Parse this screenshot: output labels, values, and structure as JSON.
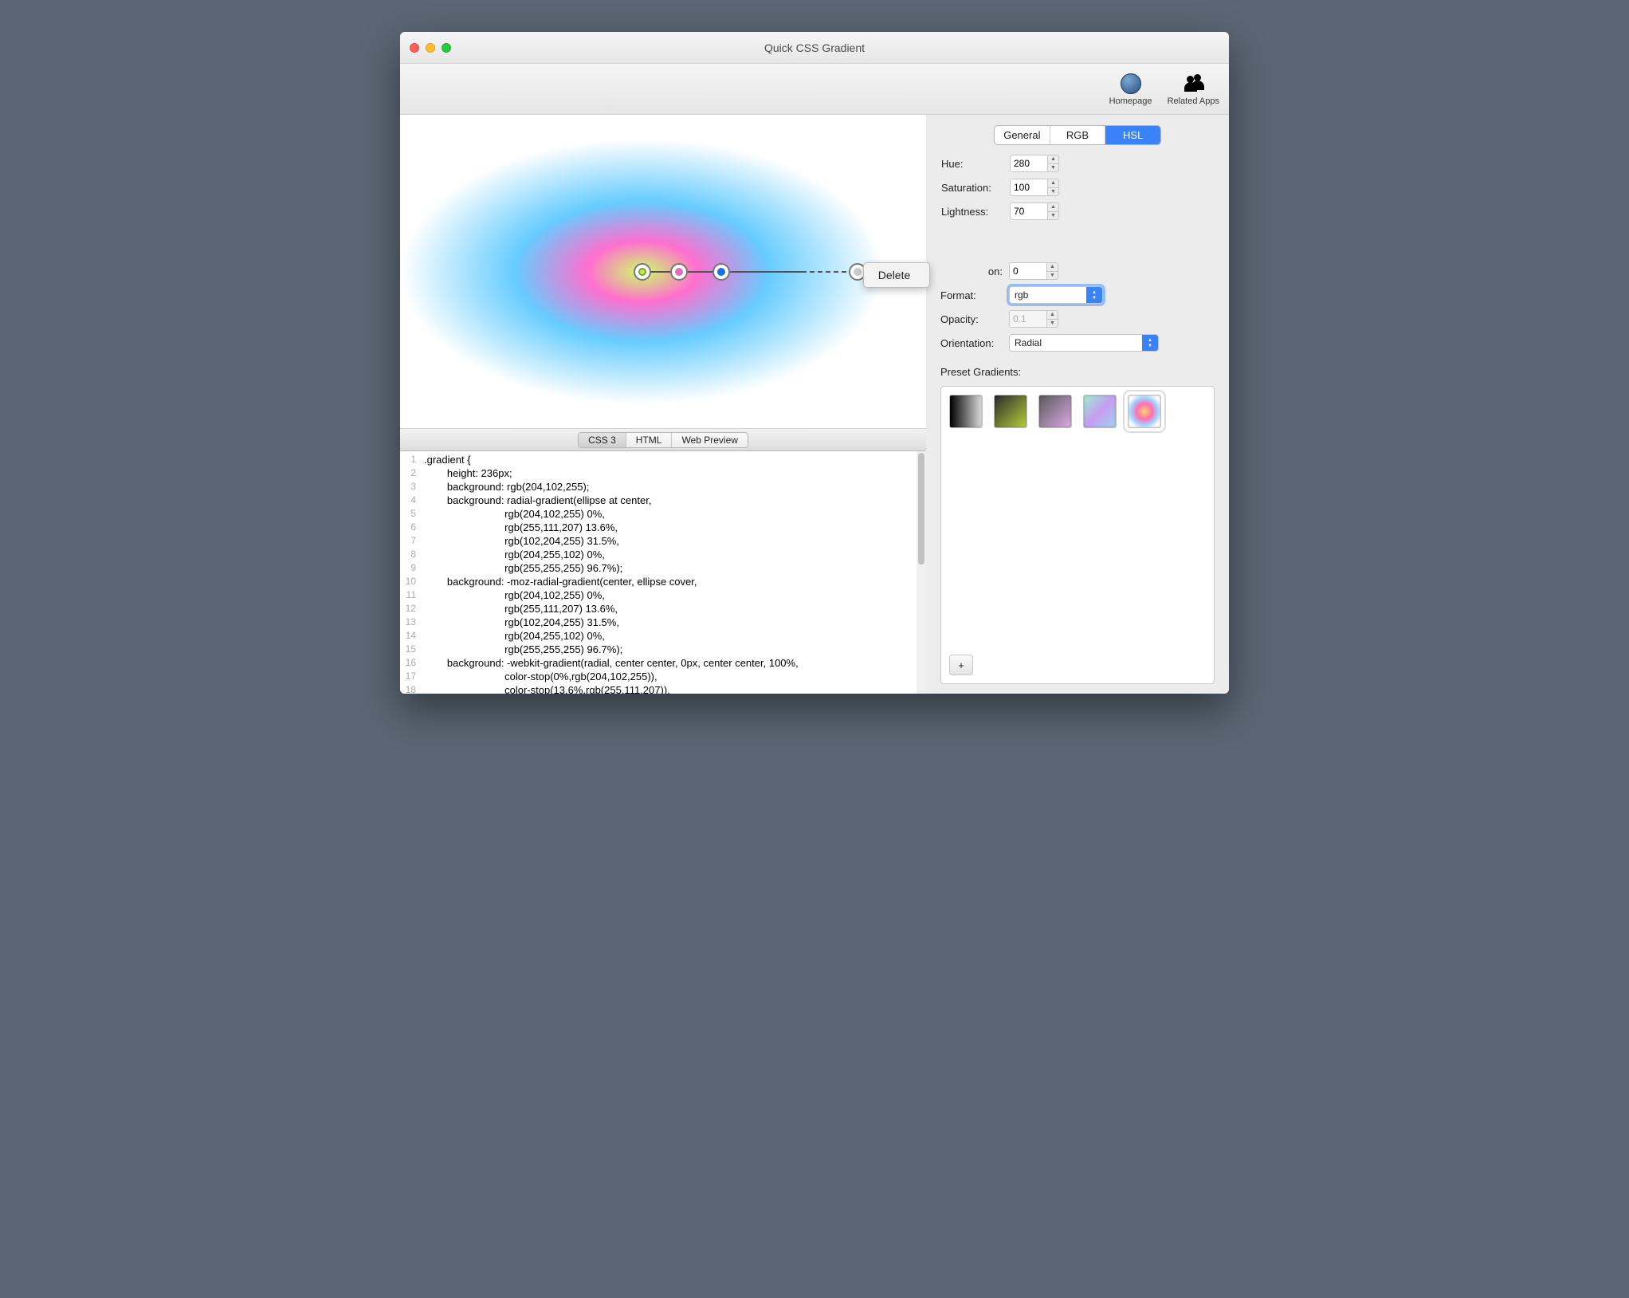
{
  "window": {
    "title": "Quick CSS Gradient"
  },
  "toolbar": {
    "homepage": "Homepage",
    "related_apps": "Related Apps"
  },
  "context_menu": {
    "delete": "Delete"
  },
  "output_tabs": {
    "css3": "CSS 3",
    "html": "HTML",
    "web_preview": "Web Preview",
    "selected": "css3"
  },
  "code_lines": [
    ".gradient {",
    "        height: 236px;",
    "        background: rgb(204,102,255);",
    "        background: radial-gradient(ellipse at center,",
    "                            rgb(204,102,255) 0%,",
    "                            rgb(255,111,207) 13.6%,",
    "                            rgb(102,204,255) 31.5%,",
    "                            rgb(204,255,102) 0%,",
    "                            rgb(255,255,255) 96.7%);",
    "        background: -moz-radial-gradient(center, ellipse cover,",
    "                            rgb(204,102,255) 0%,",
    "                            rgb(255,111,207) 13.6%,",
    "                            rgb(102,204,255) 31.5%,",
    "                            rgb(204,255,102) 0%,",
    "                            rgb(255,255,255) 96.7%);",
    "        background: -webkit-gradient(radial, center center, 0px, center center, 100%,",
    "                            color-stop(0%,rgb(204,102,255)),",
    "                            color-stop(13.6%,rgb(255,111,207)),"
  ],
  "color_tabs": {
    "general": "General",
    "rgb": "RGB",
    "hsl": "HSL",
    "selected": "hsl"
  },
  "hsl": {
    "hue_label": "Hue:",
    "hue": "280",
    "sat_label": "Saturation:",
    "sat": "100",
    "light_label": "Lightness:",
    "light": "70"
  },
  "stop": {
    "position_label_suffix": "on:",
    "position": "0",
    "format_label": "Format:",
    "format_value": "rgb",
    "opacity_label": "Opacity:",
    "opacity": "0.1",
    "orientation_label": "Orientation:",
    "orientation_value": "Radial"
  },
  "presets": {
    "label": "Preset Gradients:"
  },
  "add": {
    "symbol": "+"
  }
}
